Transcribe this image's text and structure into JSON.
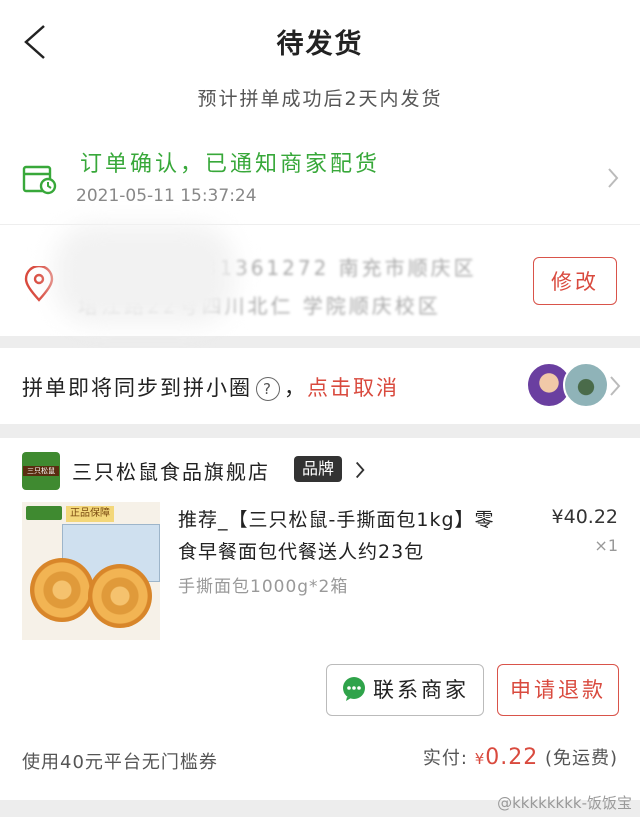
{
  "header": {
    "title": "待发货",
    "subtitle": "预计拼单成功后2天内发货"
  },
  "logistics": {
    "status": "订单确认，已通知商家配货",
    "time": "2021-05-11  15:37:24"
  },
  "address": {
    "line1": "罗水城 17381361272  南充市顺庆区",
    "line2": "培江路22号四川北仁 学院顺庆校区",
    "modify_label": "修改"
  },
  "group": {
    "text": "拼单即将同步到拼小圈",
    "help_glyph": "?",
    "separator": "，",
    "cancel_label": "点击取消"
  },
  "shop": {
    "name": "三只松鼠食品旗舰店",
    "badge": "品牌",
    "logo_text": "三只松鼠"
  },
  "product": {
    "image_badge": "正品保障",
    "title": "推荐_【三只松鼠-手撕面包1kg】零食早餐面包代餐送人约23包",
    "price": "¥40.22",
    "quantity": "×1",
    "spec": "手撕面包1000g*2箱"
  },
  "actions": {
    "contact_label": "联系商家",
    "refund_label": "申请退款"
  },
  "footer": {
    "coupon": "使用40元平台无门槛券",
    "paid_label": "实付:",
    "currency": "¥",
    "amount": "0.22",
    "shipping_note": "(免运费)"
  },
  "watermark": "@kkkkkkkk-饭饭宝",
  "colors": {
    "accent_red": "#d94a3e",
    "status_green": "#38a83a",
    "background": "#ededed"
  }
}
